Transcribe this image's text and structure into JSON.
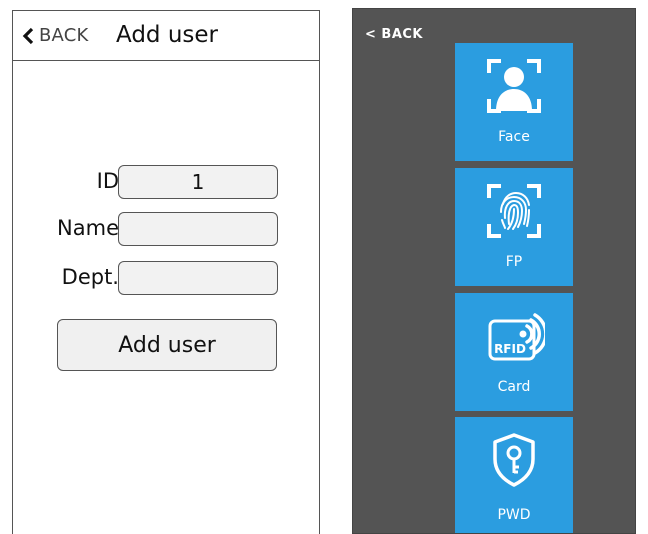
{
  "left_screen": {
    "back_label": "BACK",
    "title": "Add user",
    "fields": {
      "id_label": "ID",
      "id_value": "1",
      "name_label": "Name",
      "name_value": "",
      "dept_label": "Dept.",
      "dept_value": ""
    },
    "submit_label": "Add user"
  },
  "right_screen": {
    "back_label": "< BACK",
    "tiles": [
      {
        "label": "Face",
        "icon": "face-scan-icon"
      },
      {
        "label": "FP",
        "icon": "fingerprint-scan-icon"
      },
      {
        "label": "Card",
        "icon": "rfid-card-icon",
        "badge": "RFID"
      },
      {
        "label": "PWD",
        "icon": "password-shield-icon"
      }
    ]
  },
  "colors": {
    "tile_blue": "#2b9de0",
    "right_bg": "#545454",
    "border": "#555555"
  }
}
